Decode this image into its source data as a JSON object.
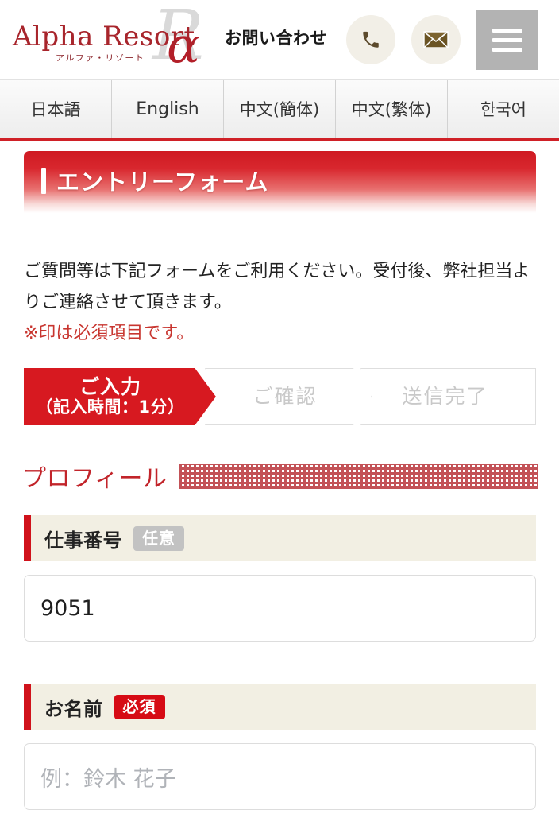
{
  "header": {
    "logo": {
      "brand": "Alpha Resort",
      "brand_kana": "アルファ・リゾート",
      "alpha_symbol": "α",
      "alpha_shadow": "R"
    },
    "cta_label": "お問い合わせ",
    "phone_icon": "phone-icon",
    "mail_icon": "mail-icon",
    "menu_icon": "hamburger-menu-icon",
    "accent_color": "#a8252c",
    "menu_bg_color": "#b3b3b3"
  },
  "language_bar": {
    "items": [
      {
        "label": "日本語"
      },
      {
        "label": "English"
      },
      {
        "label": "中文(簡体)"
      },
      {
        "label": "中文(繁体)"
      },
      {
        "label": "한국어"
      }
    ],
    "rule_color": "#cf2027"
  },
  "banner": {
    "title": "エントリーフォーム",
    "gradient_from": "#cf1a22",
    "gradient_to": "#ffffff"
  },
  "description": {
    "line1": "ご質問等は下記フォームをご利用ください。受付後、弊社担当",
    "line2": "よりご連絡させて頂きます。",
    "note": "※印は必須項目です。",
    "note_color": "#c8352f"
  },
  "steps": [
    {
      "main": "ご入力",
      "sub": "（記入時間：1分）",
      "state": "active"
    },
    {
      "main": "ご確認",
      "sub": "",
      "state": "idle"
    },
    {
      "main": "送信完了",
      "sub": "",
      "state": "idle"
    }
  ],
  "section": {
    "title": "プロフィール",
    "title_color": "#c2242a"
  },
  "fields": [
    {
      "label": "仕事番号",
      "badge": "任意",
      "badge_kind": "optional",
      "value": "9051",
      "placeholder": "",
      "filled": true
    },
    {
      "label": "お名前",
      "badge": "必須",
      "badge_kind": "required",
      "value": "",
      "placeholder": "例：鈴木 花子",
      "filled": false
    }
  ]
}
